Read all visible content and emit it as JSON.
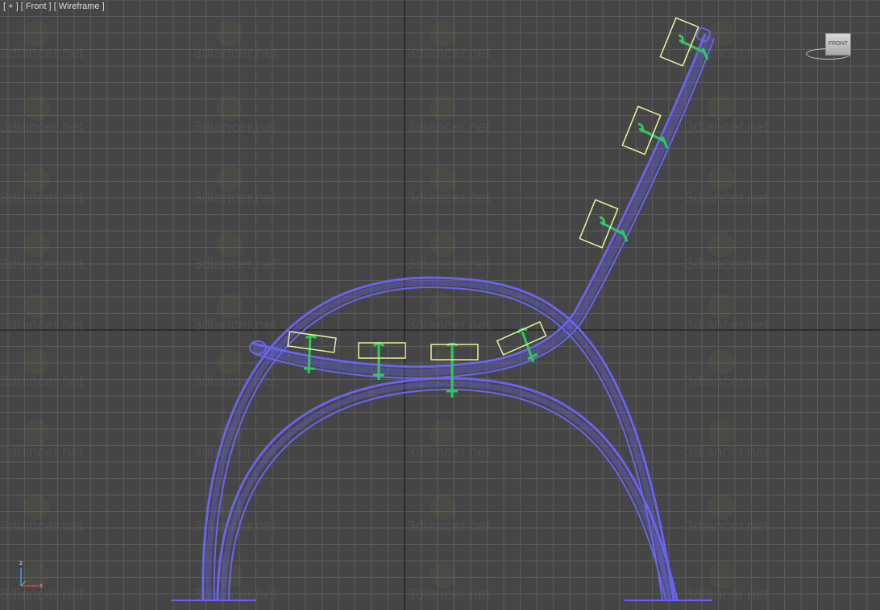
{
  "viewport": {
    "label_plus": "[ + ]",
    "label_view": "[ Front ]",
    "label_mode": "[ Wireframe ]"
  },
  "viewcube": {
    "face_label": "FRONT"
  },
  "axis_tripod": {
    "z_label": "z",
    "x_label": "x"
  },
  "watermark": {
    "text": "3dlancer.net"
  },
  "colors": {
    "grid": "#5a5a5a",
    "axis_line": "#141414",
    "bench_frame": "#6a63f0",
    "slat_outline": "#e8f59a",
    "bolt": "#2fc95c"
  }
}
